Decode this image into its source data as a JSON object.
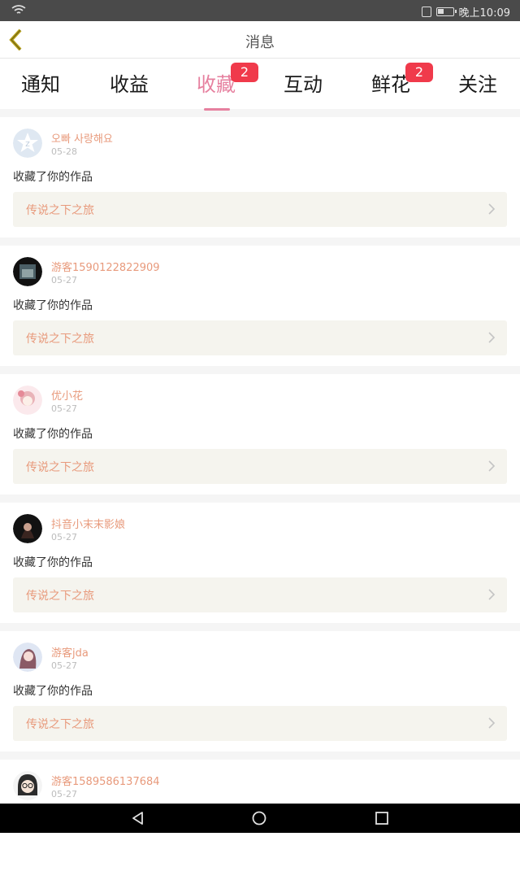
{
  "status_bar": {
    "time": "晚上10:09"
  },
  "header": {
    "title": "消息"
  },
  "tabs": [
    {
      "label": "通知",
      "active": false,
      "badge": null
    },
    {
      "label": "收益",
      "active": false,
      "badge": null
    },
    {
      "label": "收藏",
      "active": true,
      "badge": "2"
    },
    {
      "label": "互动",
      "active": false,
      "badge": null
    },
    {
      "label": "鲜花",
      "active": false,
      "badge": "2"
    },
    {
      "label": "关注",
      "active": false,
      "badge": null
    }
  ],
  "colors": {
    "accent": "#e6809f",
    "name": "#e89a7c",
    "badge": "#f03a4b"
  },
  "messages": [
    {
      "name": "오빠 사랑해요",
      "date": "05-28",
      "action": "收藏了你的作品",
      "work": "传说之下之旅",
      "avatar": "default-star-avatar"
    },
    {
      "name": "游客1590122822909",
      "date": "05-27",
      "action": "收藏了你的作品",
      "work": "传说之下之旅",
      "avatar": "dark-photo-avatar"
    },
    {
      "name": "优小花",
      "date": "05-27",
      "action": "收藏了你的作品",
      "work": "传说之下之旅",
      "avatar": "pink-anime-avatar"
    },
    {
      "name": "抖音小末末影娘",
      "date": "05-27",
      "action": "收藏了你的作品",
      "work": "传说之下之旅",
      "avatar": "dark-anime-avatar"
    },
    {
      "name": "游客jda",
      "date": "05-27",
      "action": "收藏了你的作品",
      "work": "传说之下之旅",
      "avatar": "anime-girl-avatar"
    },
    {
      "name": "游客1589586137684",
      "date": "05-27",
      "action": "",
      "work": "",
      "avatar": "glasses-character-avatar"
    }
  ]
}
